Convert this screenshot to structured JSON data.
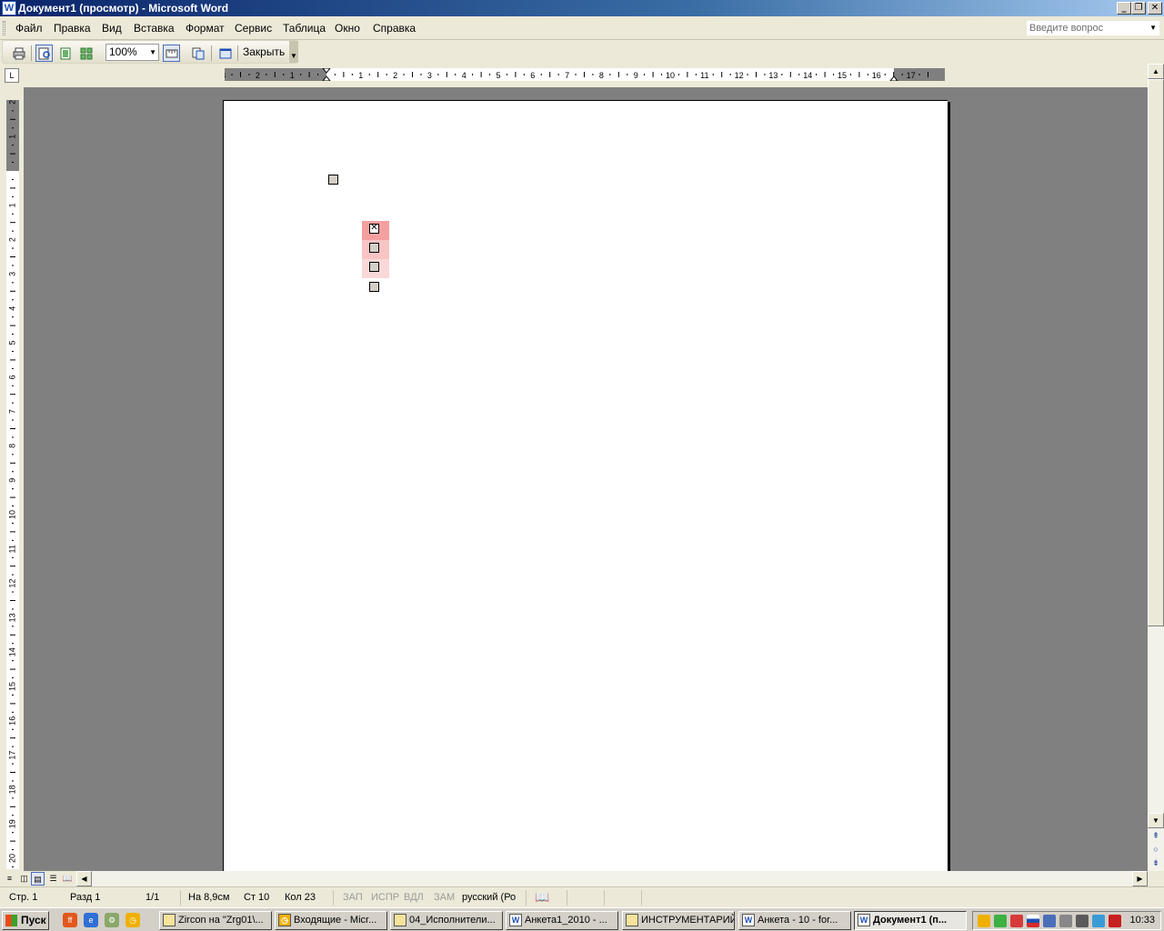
{
  "window": {
    "title": "Документ1 (просмотр) - Microsoft Word"
  },
  "menu": [
    "Файл",
    "Правка",
    "Вид",
    "Вставка",
    "Формат",
    "Сервис",
    "Таблица",
    "Окно",
    "Справка"
  ],
  "help": {
    "placeholder": "Введите вопрос"
  },
  "toolbar": {
    "zoom": "100%",
    "close_label": "Закрыть"
  },
  "ruler": {
    "horizontal_labels": [
      "3",
      "2",
      "1",
      "1",
      "2",
      "3",
      "4",
      "5",
      "6",
      "7",
      "8",
      "9",
      "10",
      "11",
      "12",
      "13",
      "14",
      "15",
      "16",
      "17"
    ],
    "vertical_labels": [
      "2",
      "1",
      "1",
      "2",
      "3",
      "4",
      "5",
      "6",
      "7",
      "8",
      "9",
      "10",
      "11",
      "12",
      "13",
      "14",
      "15",
      "16",
      "17",
      "18",
      "19",
      "20"
    ]
  },
  "document": {
    "checkboxes": [
      {
        "checked": false,
        "highlight": ""
      },
      {
        "checked": true,
        "highlight": "#f4a0a0"
      },
      {
        "checked": false,
        "highlight": "#f8c4c4"
      },
      {
        "checked": false,
        "highlight": "#fad8d8"
      },
      {
        "checked": false,
        "highlight": ""
      }
    ]
  },
  "status": {
    "page": "Стр. 1",
    "section": "Разд 1",
    "pages": "1/1",
    "at": "На 8,9см",
    "line": "Ст 10",
    "col": "Кол 23",
    "rec": "ЗАП",
    "trk": "ИСПР",
    "ext": "ВДЛ",
    "ovr": "ЗАМ",
    "language": "русский (Ро"
  },
  "taskbar": {
    "start_label": "Пуск",
    "tasks": [
      "Zircon на \"Zrg01\\...",
      "Входящие - Micr...",
      "04_Исполнители...",
      "Анкета1_2010 - ...",
      "ИНСТРУМЕНТАРИЙ",
      "Анкета - 10 - for...",
      "Документ1 (п..."
    ],
    "clock": "10:33"
  }
}
